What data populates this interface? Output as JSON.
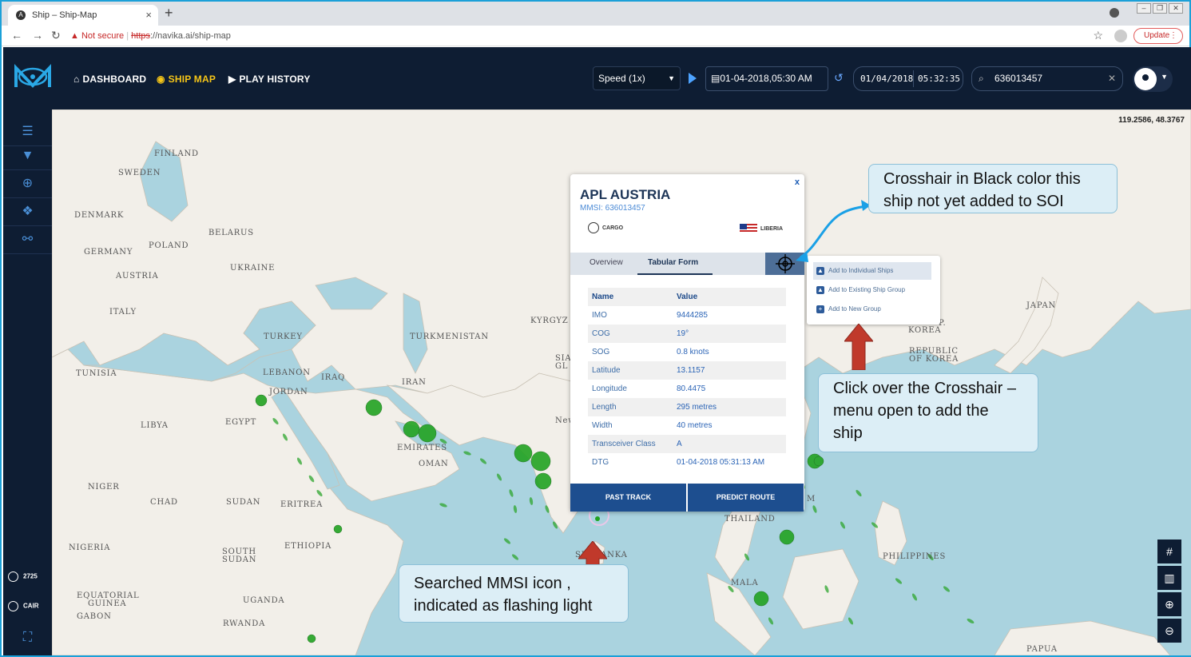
{
  "browser": {
    "tab_title": "Ship – Ship-Map",
    "tab_close": "×",
    "new_tab": "+",
    "back": "←",
    "forward": "→",
    "reload": "↻",
    "not_secure": "Not secure",
    "url_scheme": "https",
    "url_rest": "://navika.ai/ship-map",
    "update_label": "Update"
  },
  "header": {
    "nav": [
      {
        "label": "DASHBOARD",
        "icon": "home-icon"
      },
      {
        "label": "SHIP MAP",
        "icon": "target-icon"
      },
      {
        "label": "PLAY HISTORY",
        "icon": "play-circle-icon"
      }
    ],
    "speed_value": "Speed (1x)",
    "datetime_value": "01-04-2018,05:30 AM",
    "clock_date": "01/04/2018",
    "clock_time": "05:32:35",
    "search_value": "636013457"
  },
  "sidebar": {
    "ais_count": "2725",
    "cair_label": "CAIR"
  },
  "map": {
    "coords": "119.2586, 48.3767",
    "labels": [
      {
        "text": "FINLAND"
      },
      {
        "text": "SWEDEN"
      },
      {
        "text": "DENMARK"
      },
      {
        "text": "BELARUS"
      },
      {
        "text": "POLAND"
      },
      {
        "text": "GERMANY"
      },
      {
        "text": "UKRAINE"
      },
      {
        "text": "AUSTRIA"
      },
      {
        "text": "ITALY"
      },
      {
        "text": "TURKEY"
      },
      {
        "text": "TURKMENISTAN"
      },
      {
        "text": "KYRGYZ"
      },
      {
        "text": "TUNISIA"
      },
      {
        "text": "LEBANON"
      },
      {
        "text": "IRAQ"
      },
      {
        "text": "IRAN"
      },
      {
        "text": "JORDAN"
      },
      {
        "text": "LIBYA"
      },
      {
        "text": "EGYPT"
      },
      {
        "text": "EMIRATES"
      },
      {
        "text": "OMAN"
      },
      {
        "text": "NIGER"
      },
      {
        "text": "CHAD"
      },
      {
        "text": "SUDAN"
      },
      {
        "text": "ERITREA"
      },
      {
        "text": "NIGERIA"
      },
      {
        "text": "ETHIOPIA"
      },
      {
        "text": "SOUTH"
      },
      {
        "text": "SUDAN"
      },
      {
        "text": "EQUATORIAL"
      },
      {
        "text": "GUINEA"
      },
      {
        "text": "GABON"
      },
      {
        "text": "UGANDA"
      },
      {
        "text": "RWANDA"
      },
      {
        "text": "JAPAN"
      },
      {
        "text": "KOREA"
      },
      {
        "text": "REPUBLIC"
      },
      {
        "text": "OF KOREA"
      },
      {
        "text": "PHILIPPINES"
      },
      {
        "text": "THAILAND"
      },
      {
        "text": "SRI LANKA"
      },
      {
        "text": "MALA"
      },
      {
        "text": "PAPUA"
      },
      {
        "text": "SIA"
      },
      {
        "text": "GL"
      },
      {
        "text": "New"
      },
      {
        "text": "M"
      },
      {
        "text": "P."
      }
    ]
  },
  "popup": {
    "close": "x",
    "ship_name": "APL AUSTRIA",
    "mmsi": "MMSI: 636013457",
    "ship_type": "CARGO",
    "flag": "LIBERIA",
    "tab_overview": "Overview",
    "tab_tabular": "Tabular Form",
    "table_header": {
      "k": "Name",
      "v": "Value"
    },
    "rows": [
      {
        "k": "IMO",
        "v": "9444285"
      },
      {
        "k": "COG",
        "v": "19°"
      },
      {
        "k": "SOG",
        "v": "0.8 knots"
      },
      {
        "k": "Latitude",
        "v": "13.1157"
      },
      {
        "k": "Longitude",
        "v": "80.4475"
      },
      {
        "k": "Length",
        "v": "295 metres"
      },
      {
        "k": "Width",
        "v": "40 metres"
      },
      {
        "k": "Transceiver Class",
        "v": "A"
      },
      {
        "k": "DTG",
        "v": "01-04-2018 05:31:13 AM"
      }
    ],
    "past_track": "PAST TRACK",
    "predict_route": "PREDICT ROUTE"
  },
  "crosshair_menu": [
    {
      "label": "Add to Individual Ships"
    },
    {
      "label": "Add to Existing Ship Group"
    },
    {
      "label": "Add to New Group"
    }
  ],
  "callouts": {
    "crosshair_line1": "Crosshair in Black color this",
    "crosshair_line2": "ship not yet added to SOI",
    "click_line1": "Click over the Crosshair –",
    "click_line2": "menu open to add the",
    "click_line3": "ship",
    "mmsi_line1": "Searched MMSI icon ,",
    "mmsi_line2": "indicated as flashing light"
  },
  "colors": {
    "header_bg": "#0e1d33",
    "accent_yellow": "#f5c518",
    "water": "#aad3df",
    "land": "#f2efe9",
    "ship_green": "#22a322"
  }
}
